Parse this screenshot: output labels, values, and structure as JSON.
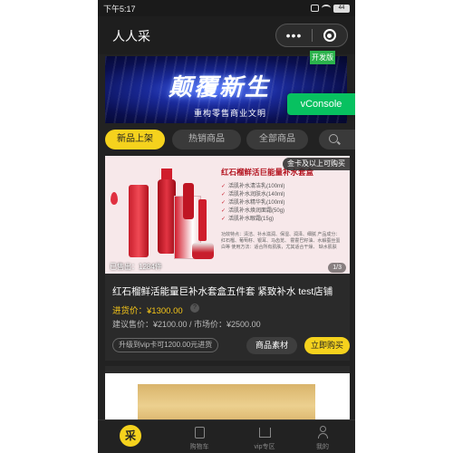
{
  "status_bar": {
    "time": "下午5:17",
    "battery": "44"
  },
  "nav": {
    "title": "人人采",
    "more_icon": "more-dots-icon",
    "close_icon": "target-icon"
  },
  "banner": {
    "headline": "颠覆新生",
    "subtitle": "重构零售商业文明",
    "dev_badge": "开发版"
  },
  "vconsole_label": "vConsole",
  "tabs": [
    {
      "label": "新品上架",
      "active": true
    },
    {
      "label": "热销商品",
      "active": false
    },
    {
      "label": "全部商品",
      "active": false
    }
  ],
  "product": {
    "promo_tag": "金卡及以上可购买",
    "image_title": "红石榴鲜活巨能量补水套盒",
    "image_items": [
      "活肌补水清洁乳(100ml)",
      "活肌补水润肤水(140ml)",
      "活肌补水精华乳(100ml)",
      "活肌补水焕润面霜(50g)",
      "活肌补水眼霜(15g)"
    ],
    "image_foot": "功效特点：清洁、补水滋润、保湿、润泽、细腻 产品成分：红石榴、葡萄籽、银耳、马齿苋、 霍霍巴籽油、水解蚕丝蛋白等 使用方法：适合所有肌肤，尤其适合干燥、 缺水肌肤",
    "sales": "已售出：1284件",
    "pager": "1/3",
    "title": "红石榴鲜活能量巨补水套盒五件套 紧致补水 test店铺",
    "cost_label": "进货价：",
    "cost_value": "¥1300.00",
    "help_icon": "?",
    "suggest_text": "建议售价：¥2100.00 / 市场价：¥2500.00",
    "vip_text": "升级到vip卡可1200.00元进货",
    "material_button": "商品素材",
    "buy_button": "立即购买"
  },
  "tabbar": {
    "items": [
      {
        "label": "",
        "icon": "home-logo-icon",
        "glyph": "采"
      },
      {
        "label": "购物车",
        "icon": "cart-icon"
      },
      {
        "label": "vip专区",
        "icon": "crown-icon"
      },
      {
        "label": "我的",
        "icon": "user-icon"
      }
    ]
  },
  "colors": {
    "accent": "#f5d21d",
    "background": "#222222",
    "price": "#f5c518",
    "vconsole": "#07c160"
  }
}
